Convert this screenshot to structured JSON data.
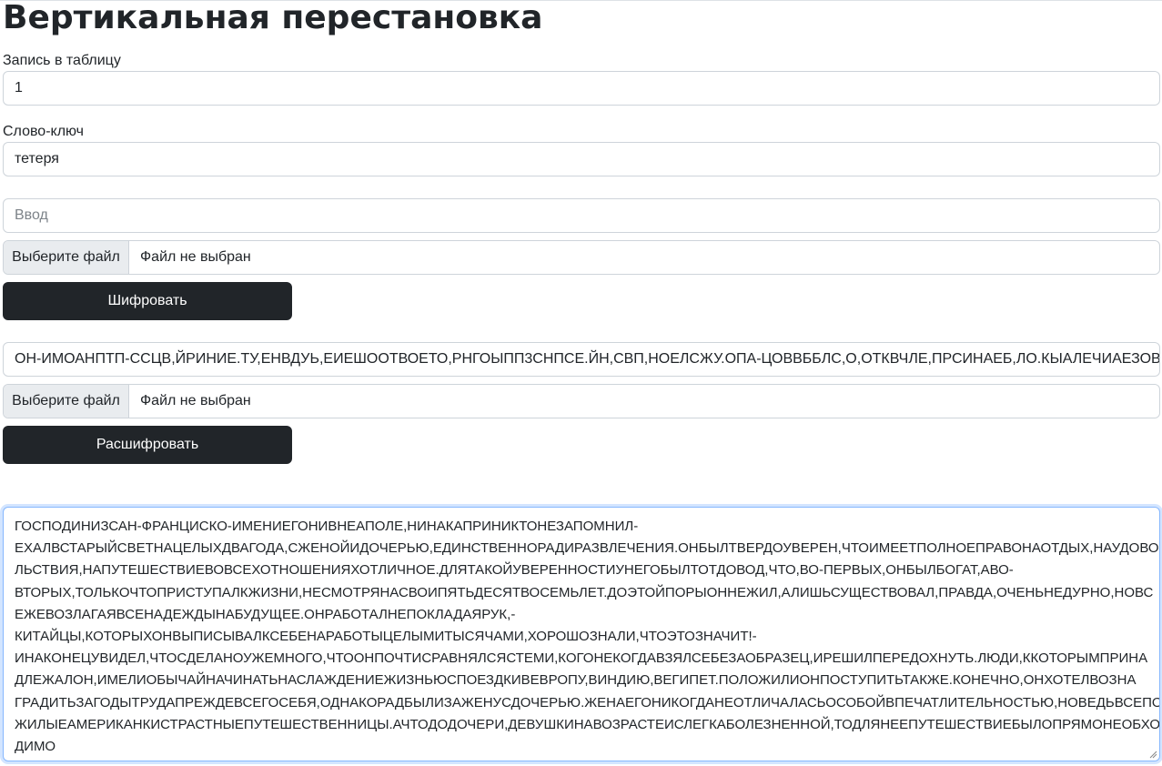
{
  "page": {
    "title": "Вертикальная перестановка"
  },
  "table_write": {
    "label": "Запись в таблицу",
    "value": "1"
  },
  "keyword": {
    "label": "Слово-ключ",
    "value": "тетеря"
  },
  "encrypt": {
    "input_placeholder": "Ввод",
    "file_button": "Выберите файл",
    "file_status": "Файл не выбран",
    "submit_label": "Шифровать"
  },
  "decrypt": {
    "input_value": "ОН-ИМОАНПТП-ССЦВ,ЙРИНИЕ.ТУ,ЕНВДУЬ,ЕИЕШООТВОЕТО,РНГОЫПП3СНПСЕ.ЙН,СВП,НОЕЛСЖУ.ОПА-ЦОВВББЛС,О,ОТКВЧЛЕ,ПРСИНАЕБ,ЛО.КЫАЛЕЧИАЕЗОВУИИОИТТ",
    "file_button": "Выберите файл",
    "file_status": "Файл не выбран",
    "submit_label": "Расшифровать"
  },
  "output": {
    "lines": [
      "ГОСПОДИНИЗСАН-ФРАНЦИСКО-ИМЕНИЕГОНИВНЕАПОЛЕ,НИНАКАПРИНИКТОНЕЗАПОМНИЛ-",
      "ЕХАЛВСТАРЫЙСВЕТНАЦЕЛЫХДВАГОДА,СЖЕНОЙИДОЧЕРЬЮ,ЕДИНСТВЕННОРАДИРАЗВЛЕЧЕНИЯ.ОНБЫЛТВЕРДОУВЕРЕН,ЧТОИМЕЕТПОЛНОЕПРАВОНАОТДЫХ,НАУДОВО",
      "ЛЬСТВИЯ,НАПУТЕШЕСТВИЕВОВСЕХОТНОШЕНИЯХОТЛИЧНОЕ.ДЛЯТАКОЙУВЕРЕННОСТИУНЕГОБЫЛТОТДОВОД,ЧТО,ВО-ПЕРВЫХ,ОНБЫЛБОГАТ,АВО-",
      "ВТОРЫХ,ТОЛЬКОЧТОПРИСТУПАЛКЖИЗНИ,НЕСМОТРЯНАСВОИПЯТЬДЕСЯТВОСЕМЬЛЕТ.ДОЭТОЙПОРЫОННЕЖИЛ,АЛИШЬСУЩЕСТВОВАЛ,ПРАВДА,ОЧЕНЬНЕДУРНО,НОВС",
      "ЕЖЕВОЗЛАГАЯВСЕНАДЕЖДЫНАБУДУЩЕЕ.ОНРАБОТАЛНЕПОКЛАДАЯРУК,-",
      "КИТАЙЦЫ,КОТОРЫХОНВЫПИСЫВАЛКСЕБЕНАРАБОТЫЦЕЛЫМИТЫСЯЧАМИ,ХОРОШОЗНАЛИ,ЧТОЭТОЗНАЧИТ!-",
      "ИНАКОНЕЦУВИДЕЛ,ЧТОСДЕЛАНОУЖЕМНОГО,ЧТООНПОЧТИСРАВНЯЛСЯСТЕМИ,КОГОНЕКОГДАВЗЯЛСЕБЕЗАОБРАЗЕЦ,ИРЕШИЛПЕРЕДОХНУТЬ.ЛЮДИ,ККОТОРЫМПРИНА",
      "ДЛЕЖАЛОН,ИМЕЛИОБЫЧАЙНАЧИНАТЬНАСЛАЖДЕНИЕЖИЗНЬЮСПОЕЗДКИВЕВРОПУ,ВИНДИЮ,ВЕГИПЕТ.ПОЛОЖИЛИОНПОСТУПИТЬТАКЖЕ.КОНЕЧНО,ОНХОТЕЛВОЗНА",
      "ГРАДИТЬЗАГОДЫТРУДАПРЕЖДЕВСЕГОСЕБЯ,ОДНАКОРАДБЫЛИЗАЖЕНУСДОЧЕРЬЮ.ЖЕНАЕГОНИКОГДАНЕОТЛИЧАЛАСЬОСОБОЙВПЕЧАТЛИТЕЛЬНОСТЬЮ,НОВЕДЬВСЕПО",
      "ЖИЛЫЕАМЕРИКАНКИСТРАСТНЫЕПУТЕШЕСТВЕННИЦЫ.АЧТОДОДОЧЕРИ,ДЕВУШКИНАВОЗРАСТЕИСЛЕГКАБОЛЕЗНЕННОЙ,ТОДЛЯНЕЕПУТЕШЕСТВИЕБЫЛОПРЯМОНЕОБХО",
      "ДИМО"
    ]
  }
}
